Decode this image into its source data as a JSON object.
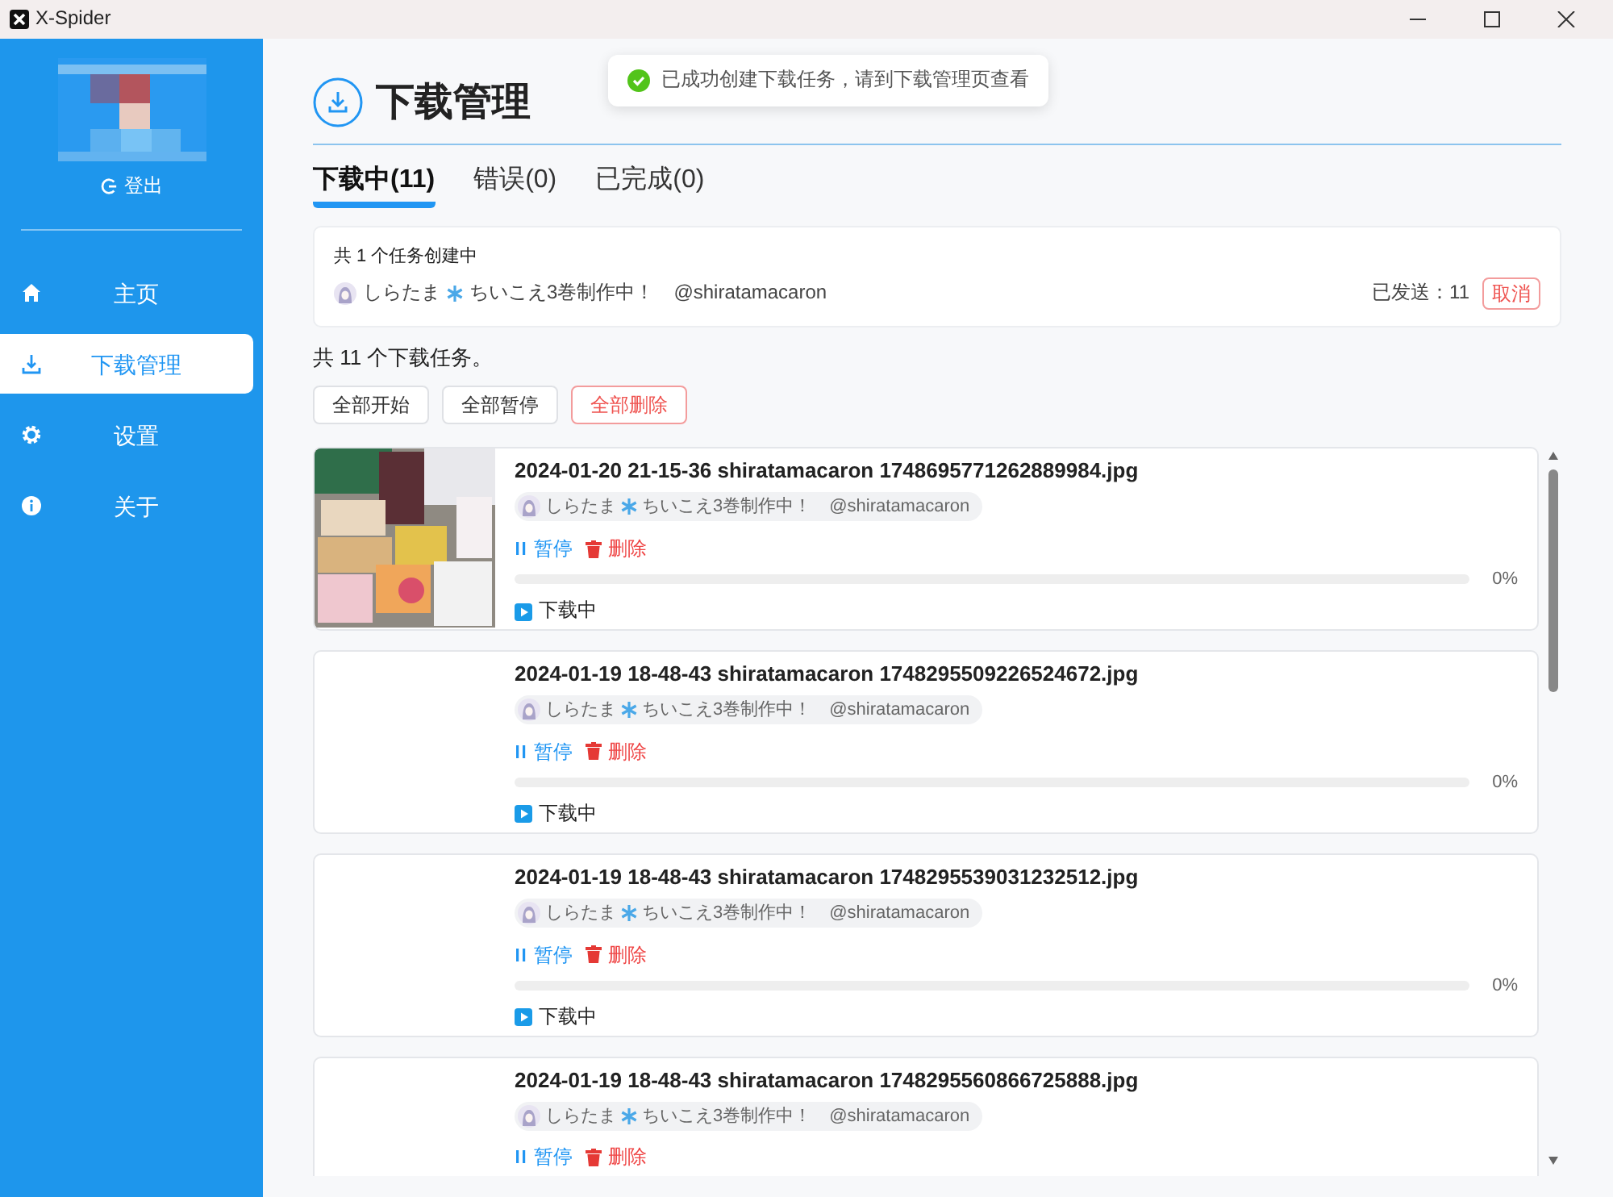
{
  "window": {
    "title": "X-Spider"
  },
  "sidebar": {
    "logout": "登出",
    "items": [
      {
        "label": "主页",
        "selected": false
      },
      {
        "label": "下载管理",
        "selected": true
      },
      {
        "label": "设置",
        "selected": false
      },
      {
        "label": "关于",
        "selected": false
      }
    ]
  },
  "toast": {
    "message": "已成功创建下载任务，请到下载管理页查看"
  },
  "page": {
    "title": "下载管理"
  },
  "tabs": [
    {
      "label": "下载中(11)",
      "selected": true
    },
    {
      "label": "错误(0)",
      "selected": false
    },
    {
      "label": "已完成(0)",
      "selected": false
    }
  ],
  "creating": {
    "summary": "共 1 个任务创建中",
    "user_name": "しらたま",
    "user_status": "ちいこえ3巻制作中！",
    "handle": "@shiratamacaron",
    "sent": "已发送：11",
    "cancel": "取消"
  },
  "task_count": "共 11 个下载任务。",
  "bulk_buttons": [
    {
      "label": "全部开始",
      "kind": "normal"
    },
    {
      "label": "全部暂停",
      "kind": "normal"
    },
    {
      "label": "全部删除",
      "kind": "danger"
    }
  ],
  "tasks": [
    {
      "title": "2024-01-20 21-15-36 shiratamacaron 1748695771262889984.jpg",
      "has_thumbnail": true,
      "user_name": "しらたま",
      "user_status": "ちいこえ3巻制作中！",
      "handle": "@shiratamacaron",
      "pause": "暂停",
      "delete": "删除",
      "level": 0,
      "percent": "0%",
      "status": "下载中"
    },
    {
      "title": "2024-01-19 18-48-43 shiratamacaron 1748295509226524672.jpg",
      "has_thumbnail": false,
      "user_name": "しらたま",
      "user_status": "ちいこえ3巻制作中！",
      "handle": "@shiratamacaron",
      "pause": "暂停",
      "delete": "删除",
      "level": 0,
      "percent": "0%",
      "status": "下载中"
    },
    {
      "title": "2024-01-19 18-48-43 shiratamacaron 1748295539031232512.jpg",
      "has_thumbnail": false,
      "user_name": "しらたま",
      "user_status": "ちいこえ3巻制作中！",
      "handle": "@shiratamacaron",
      "pause": "暂停",
      "delete": "删除",
      "level": 0,
      "percent": "0%",
      "status": "下载中"
    },
    {
      "title": "2024-01-19 18-48-43 shiratamacaron 1748295560866725888.jpg",
      "has_thumbnail": false,
      "user_name": "しらたま",
      "user_status": "ちいこえ3巻制作中！",
      "handle": "@shiratamacaron",
      "pause": "暂停",
      "delete": "删除"
    }
  ]
}
